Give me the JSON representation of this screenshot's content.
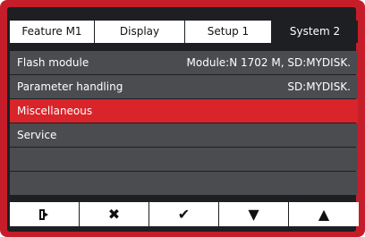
{
  "tabs": [
    {
      "label": "Feature  M1",
      "active": false
    },
    {
      "label": "Display",
      "active": false
    },
    {
      "label": "Setup 1",
      "active": false
    },
    {
      "label": "System 2",
      "active": true
    }
  ],
  "menu": [
    {
      "label": "Flash module",
      "value": "Module:N 1702 M, SD:MYDISK."
    },
    {
      "label": "Parameter handling",
      "value": "SD:MYDISK."
    },
    {
      "label": "Miscellaneous",
      "value": "",
      "selected": true
    },
    {
      "label": "Service",
      "value": ""
    },
    {
      "label": "",
      "value": ""
    },
    {
      "label": "",
      "value": ""
    }
  ],
  "softkeys": [
    {
      "icon": "exit-icon",
      "glyph": "⇥"
    },
    {
      "icon": "cancel-icon",
      "glyph": "✖"
    },
    {
      "icon": "confirm-icon",
      "glyph": "✔"
    },
    {
      "icon": "arrow-down-icon",
      "glyph": "▼"
    },
    {
      "icon": "arrow-up-icon",
      "glyph": "▲"
    }
  ],
  "colors": {
    "bezel": "#c51e2a",
    "panel": "#1e1f22",
    "row": "#4b4c50",
    "selected": "#d9242a"
  }
}
